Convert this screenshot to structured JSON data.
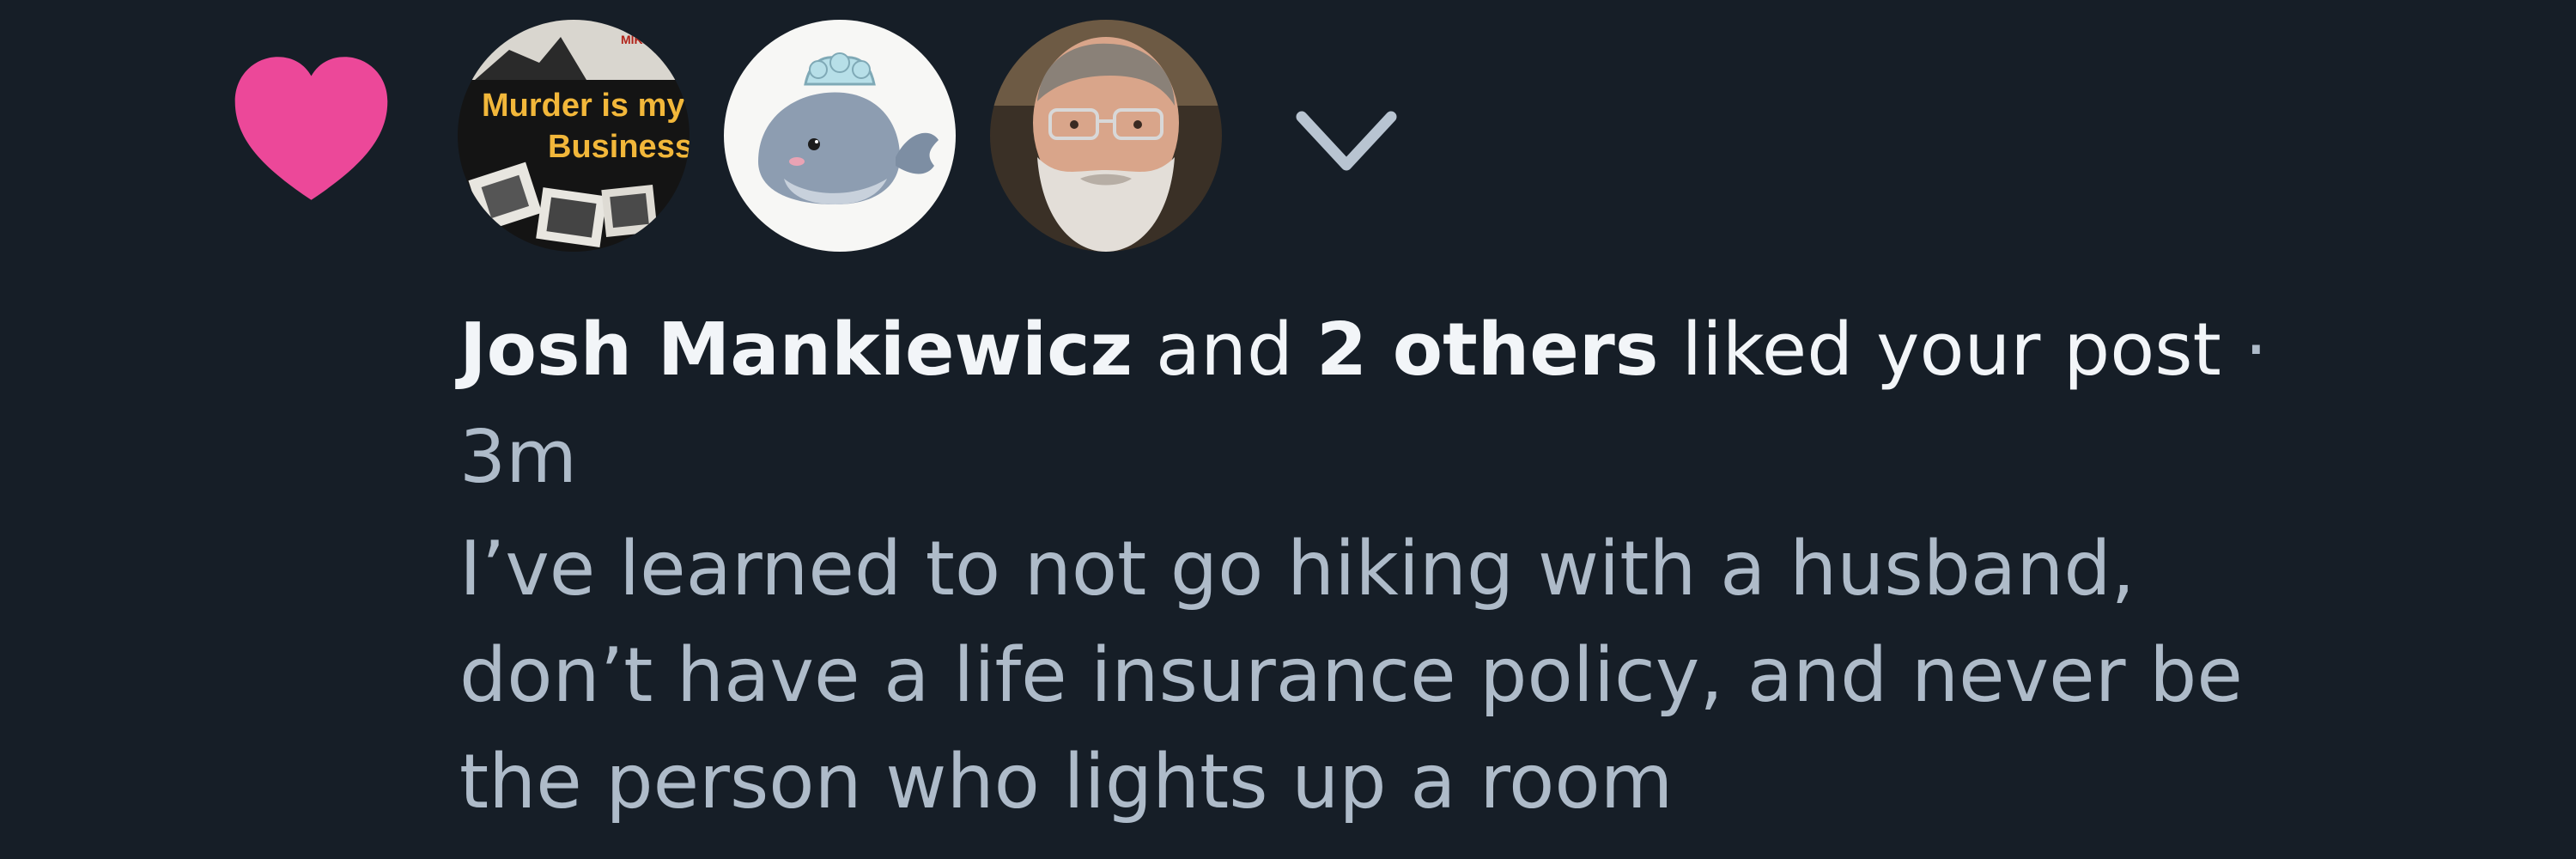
{
  "notification": {
    "icon": "heart-icon",
    "like_color": "#ec4899",
    "avatars": [
      {
        "alt": "Murder is my Business book cover avatar",
        "cover_top": "MIKE SHAYNE MYSTERY",
        "cover_title_1": "Murder is my",
        "cover_title_2": "Business"
      },
      {
        "alt": "whale illustration avatar"
      },
      {
        "alt": "bearded man with glasses avatar"
      }
    ],
    "expand_icon": "chevron-down-icon",
    "actor_name": "Josh Mankiewicz",
    "joiner": "and",
    "others": "2 others",
    "action": "liked your post",
    "separator": "·",
    "time": "3m",
    "post_text": "I’ve learned to not go hiking with a husband,\ndon’t have a life insurance policy, and never be\nthe person who lights up a room"
  }
}
